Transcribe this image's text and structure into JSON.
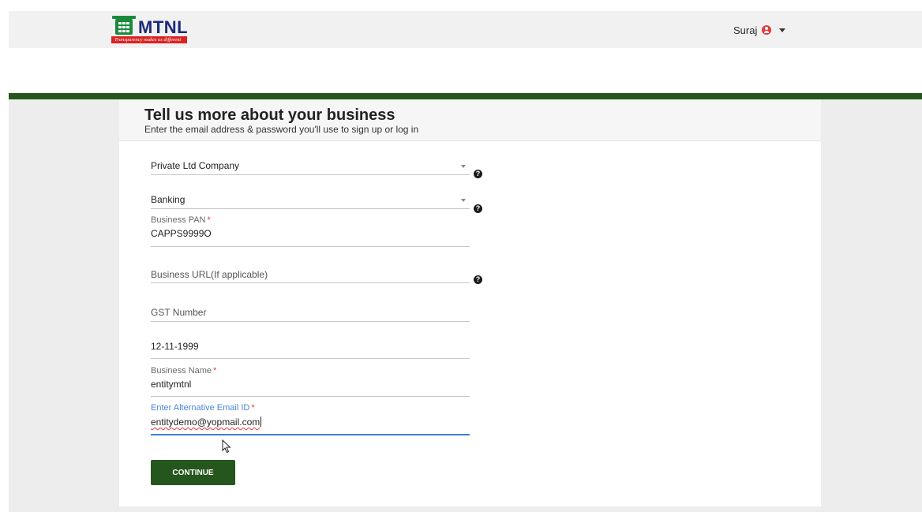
{
  "header": {
    "logo_text": "MTNL",
    "logo_tagline": "Transparency makes us different",
    "user_name": "Suraj"
  },
  "form": {
    "title": "Tell us more about your business",
    "subtitle": "Enter the email address & password you'll use to sign up or log in",
    "company_type": "Private Ltd Company",
    "industry": "Banking",
    "pan_label": "Business PAN",
    "pan_value": "CAPPS9999O",
    "url_placeholder": "Business URL(If applicable)",
    "gst_placeholder": "GST Number",
    "date_value": "12-11-1999",
    "name_label": "Business Name",
    "name_value": "entitymtnl",
    "email_label": "Enter Alternative Email ID",
    "email_value": "entitydemo@yopmail.com",
    "required_mark": "*",
    "help_glyph": "?",
    "continue_label": "CONTINUE"
  },
  "colors": {
    "accent_green": "#25561d",
    "focus_blue": "#3f7fd6",
    "required_red": "#e53935"
  },
  "icons": [
    "user-icon",
    "chevron-down-icon",
    "help-icon",
    "mouse-pointer-icon"
  ]
}
